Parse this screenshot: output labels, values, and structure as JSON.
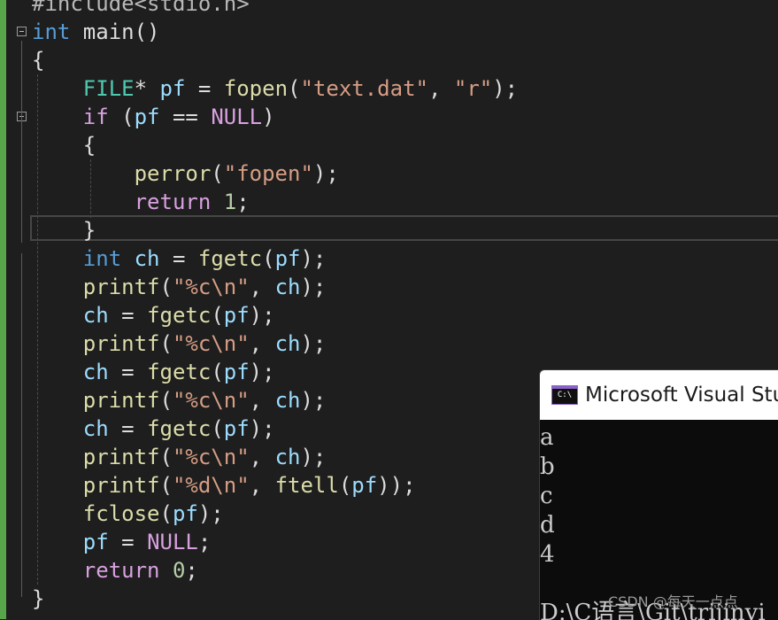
{
  "editor": {
    "lines": [
      {
        "tokens": [
          {
            "t": "#include<stdio.h>",
            "c": "x"
          }
        ]
      },
      {
        "tokens": [
          {
            "t": "int",
            "c": "k"
          },
          {
            "t": " main()",
            "c": ""
          }
        ]
      },
      {
        "tokens": [
          {
            "t": "{",
            "c": ""
          }
        ]
      },
      {
        "tokens": [
          {
            "t": "    ",
            "c": ""
          },
          {
            "t": "FILE",
            "c": "t"
          },
          {
            "t": "* ",
            "c": ""
          },
          {
            "t": "pf",
            "c": "v"
          },
          {
            "t": " = ",
            "c": ""
          },
          {
            "t": "fopen",
            "c": "f"
          },
          {
            "t": "(",
            "c": ""
          },
          {
            "t": "\"text.dat\"",
            "c": "s"
          },
          {
            "t": ", ",
            "c": ""
          },
          {
            "t": "\"r\"",
            "c": "s"
          },
          {
            "t": ");",
            "c": ""
          }
        ]
      },
      {
        "tokens": [
          {
            "t": "    ",
            "c": ""
          },
          {
            "t": "if",
            "c": "c"
          },
          {
            "t": " (",
            "c": ""
          },
          {
            "t": "pf",
            "c": "v"
          },
          {
            "t": " == ",
            "c": ""
          },
          {
            "t": "NULL",
            "c": "c"
          },
          {
            "t": ")",
            "c": ""
          }
        ]
      },
      {
        "tokens": [
          {
            "t": "    {",
            "c": ""
          }
        ]
      },
      {
        "tokens": [
          {
            "t": "        ",
            "c": ""
          },
          {
            "t": "perror",
            "c": "f"
          },
          {
            "t": "(",
            "c": ""
          },
          {
            "t": "\"fopen\"",
            "c": "s"
          },
          {
            "t": ");",
            "c": ""
          }
        ]
      },
      {
        "tokens": [
          {
            "t": "        ",
            "c": ""
          },
          {
            "t": "return",
            "c": "c"
          },
          {
            "t": " ",
            "c": ""
          },
          {
            "t": "1",
            "c": "n"
          },
          {
            "t": ";",
            "c": ""
          }
        ]
      },
      {
        "tokens": [
          {
            "t": "    }",
            "c": ""
          }
        ]
      },
      {
        "tokens": [
          {
            "t": "    ",
            "c": ""
          },
          {
            "t": "int",
            "c": "k"
          },
          {
            "t": " ",
            "c": ""
          },
          {
            "t": "ch",
            "c": "v"
          },
          {
            "t": " = ",
            "c": ""
          },
          {
            "t": "fgetc",
            "c": "f"
          },
          {
            "t": "(",
            "c": ""
          },
          {
            "t": "pf",
            "c": "v"
          },
          {
            "t": ");",
            "c": ""
          }
        ]
      },
      {
        "tokens": [
          {
            "t": "    ",
            "c": ""
          },
          {
            "t": "printf",
            "c": "f"
          },
          {
            "t": "(",
            "c": ""
          },
          {
            "t": "\"%c\\n\"",
            "c": "s"
          },
          {
            "t": ", ",
            "c": ""
          },
          {
            "t": "ch",
            "c": "v"
          },
          {
            "t": ");",
            "c": ""
          }
        ]
      },
      {
        "tokens": [
          {
            "t": "    ",
            "c": ""
          },
          {
            "t": "ch",
            "c": "v"
          },
          {
            "t": " = ",
            "c": ""
          },
          {
            "t": "fgetc",
            "c": "f"
          },
          {
            "t": "(",
            "c": ""
          },
          {
            "t": "pf",
            "c": "v"
          },
          {
            "t": ");",
            "c": ""
          }
        ]
      },
      {
        "tokens": [
          {
            "t": "    ",
            "c": ""
          },
          {
            "t": "printf",
            "c": "f"
          },
          {
            "t": "(",
            "c": ""
          },
          {
            "t": "\"%c\\n\"",
            "c": "s"
          },
          {
            "t": ", ",
            "c": ""
          },
          {
            "t": "ch",
            "c": "v"
          },
          {
            "t": ");",
            "c": ""
          }
        ]
      },
      {
        "tokens": [
          {
            "t": "    ",
            "c": ""
          },
          {
            "t": "ch",
            "c": "v"
          },
          {
            "t": " = ",
            "c": ""
          },
          {
            "t": "fgetc",
            "c": "f"
          },
          {
            "t": "(",
            "c": ""
          },
          {
            "t": "pf",
            "c": "v"
          },
          {
            "t": ");",
            "c": ""
          }
        ]
      },
      {
        "tokens": [
          {
            "t": "    ",
            "c": ""
          },
          {
            "t": "printf",
            "c": "f"
          },
          {
            "t": "(",
            "c": ""
          },
          {
            "t": "\"%c\\n\"",
            "c": "s"
          },
          {
            "t": ", ",
            "c": ""
          },
          {
            "t": "ch",
            "c": "v"
          },
          {
            "t": ");",
            "c": ""
          }
        ]
      },
      {
        "tokens": [
          {
            "t": "    ",
            "c": ""
          },
          {
            "t": "ch",
            "c": "v"
          },
          {
            "t": " = ",
            "c": ""
          },
          {
            "t": "fgetc",
            "c": "f"
          },
          {
            "t": "(",
            "c": ""
          },
          {
            "t": "pf",
            "c": "v"
          },
          {
            "t": ");",
            "c": ""
          }
        ]
      },
      {
        "tokens": [
          {
            "t": "    ",
            "c": ""
          },
          {
            "t": "printf",
            "c": "f"
          },
          {
            "t": "(",
            "c": ""
          },
          {
            "t": "\"%c\\n\"",
            "c": "s"
          },
          {
            "t": ", ",
            "c": ""
          },
          {
            "t": "ch",
            "c": "v"
          },
          {
            "t": ");",
            "c": ""
          }
        ]
      },
      {
        "tokens": [
          {
            "t": "    ",
            "c": ""
          },
          {
            "t": "printf",
            "c": "f"
          },
          {
            "t": "(",
            "c": ""
          },
          {
            "t": "\"%d\\n\"",
            "c": "s"
          },
          {
            "t": ", ",
            "c": ""
          },
          {
            "t": "ftell",
            "c": "f"
          },
          {
            "t": "(",
            "c": ""
          },
          {
            "t": "pf",
            "c": "v"
          },
          {
            "t": "));",
            "c": ""
          }
        ]
      },
      {
        "tokens": [
          {
            "t": "    ",
            "c": ""
          },
          {
            "t": "fclose",
            "c": "f"
          },
          {
            "t": "(",
            "c": ""
          },
          {
            "t": "pf",
            "c": "v"
          },
          {
            "t": ");",
            "c": ""
          }
        ]
      },
      {
        "tokens": [
          {
            "t": "    ",
            "c": ""
          },
          {
            "t": "pf",
            "c": "v"
          },
          {
            "t": " = ",
            "c": ""
          },
          {
            "t": "NULL",
            "c": "c"
          },
          {
            "t": ";",
            "c": ""
          }
        ]
      },
      {
        "tokens": [
          {
            "t": "    ",
            "c": ""
          },
          {
            "t": "return",
            "c": "c"
          },
          {
            "t": " ",
            "c": ""
          },
          {
            "t": "0",
            "c": "n"
          },
          {
            "t": ";",
            "c": ""
          }
        ]
      },
      {
        "tokens": [
          {
            "t": "}",
            "c": ""
          }
        ]
      }
    ]
  },
  "console": {
    "icon_text": "C:\\",
    "title": "Microsoft Visual Studio Debug Console",
    "output": [
      "a",
      "b",
      "c",
      "d",
      "4",
      "",
      "D:\\C语言\\Git\\trijinyi"
    ],
    "watermark": "CSDN @每天一点点"
  }
}
